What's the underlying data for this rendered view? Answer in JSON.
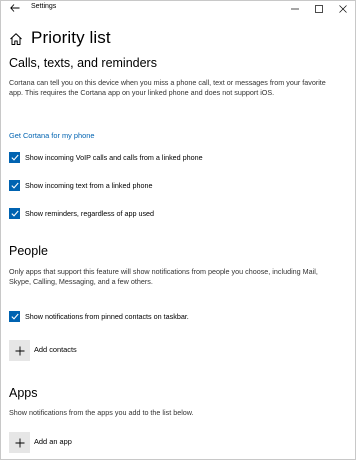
{
  "window": {
    "app_title": "Settings"
  },
  "header": {
    "page_title": "Priority list"
  },
  "calls_section": {
    "title": "Calls, texts, and reminders",
    "description": "Cortana can tell you on this device when you miss a phone call, text or messages from your favorite app. This requires the Cortana app on your linked phone and does not support iOS.",
    "link": "Get Cortana for my phone",
    "checkboxes": [
      {
        "label": "Show incoming VoIP calls and calls from a linked phone",
        "checked": true
      },
      {
        "label": "Show incoming text from a linked phone",
        "checked": true
      },
      {
        "label": "Show reminders, regardless of app used",
        "checked": true
      }
    ]
  },
  "people_section": {
    "title": "People",
    "description": "Only apps that support this feature will show notifications from people you choose, including Mail, Skype, Calling, Messaging, and a few others.",
    "checkbox": {
      "label": "Show notifications from pinned contacts on taskbar.",
      "checked": true
    },
    "add_label": "Add contacts"
  },
  "apps_section": {
    "title": "Apps",
    "description": "Show notifications from the apps you add to the list below.",
    "add_label": "Add an app"
  },
  "colors": {
    "accent": "#0063b1",
    "tile": "#e6e6e6"
  },
  "icons": [
    "back-arrow-icon",
    "minimize-icon",
    "maximize-icon",
    "close-icon",
    "home-icon",
    "checkmark-icon",
    "plus-icon"
  ]
}
